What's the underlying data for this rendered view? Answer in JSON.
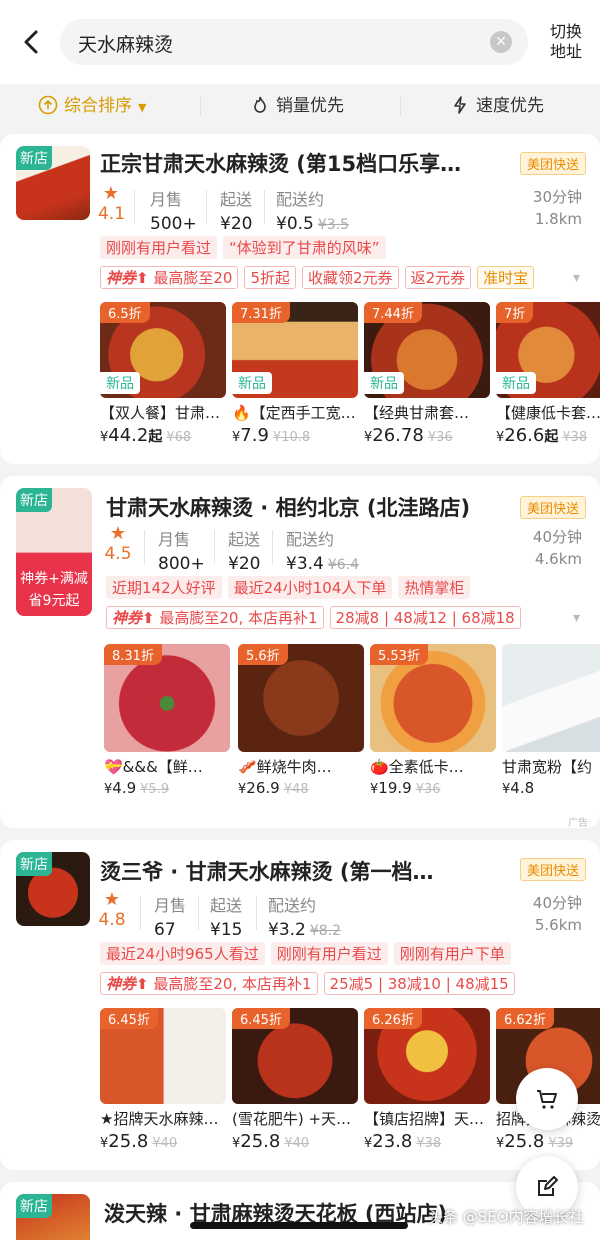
{
  "search": {
    "query": "天水麻辣烫",
    "switch_label": "切换\n地址"
  },
  "sort": {
    "tabs": [
      "综合排序",
      "销量优先",
      "速度优先"
    ]
  },
  "stat_labels": {
    "monthly": "月售",
    "min": "起送",
    "delivery": "配送约"
  },
  "stores": [
    {
      "new_label": "新店",
      "name": "正宗甘肃天水麻辣烫 (第15档口乐享…",
      "badge": "美团快送",
      "rating": "4.1",
      "monthly": "500+",
      "min_order": "¥20",
      "delivery_fee": "¥0.5",
      "delivery_fee_orig": "¥3.5",
      "time": "30分钟",
      "distance": "1.8km",
      "tags": [
        "刚刚有用户看过",
        "“体验到了甘肃的风味”"
      ],
      "coupons": {
        "shen": "神券",
        "boost": "最高膨至20",
        "items": [
          "5折起",
          "收藏领2元券",
          "返2元券",
          "准时宝"
        ]
      },
      "dishes": [
        {
          "discount": "6.5折",
          "new": "新品",
          "name": "【双人餐】甘肃…",
          "price": "44.2",
          "suffix": "起",
          "orig": "¥68"
        },
        {
          "discount": "7.31折",
          "new": "新品",
          "name": "🔥【定西手工宽…",
          "price": "7.9",
          "suffix": "",
          "orig": "¥10.8"
        },
        {
          "discount": "7.44折",
          "new": "新品",
          "name": "【经典甘肃套…",
          "price": "26.78",
          "suffix": "",
          "orig": "¥36"
        },
        {
          "discount": "7折",
          "new": "新品",
          "name": "【健康低卡套…",
          "price": "26.6",
          "suffix": "起",
          "orig": "¥38"
        }
      ]
    },
    {
      "new_label": "新店",
      "logo_promo": "神券+满减\n省9元起",
      "name": "甘肃天水麻辣烫 · 相约北京 (北洼路店)",
      "badge": "美团快送",
      "rating": "4.5",
      "monthly": "800+",
      "min_order": "¥20",
      "delivery_fee": "¥3.4",
      "delivery_fee_orig": "¥6.4",
      "time": "40分钟",
      "distance": "4.6km",
      "tags": [
        "近期142人好评",
        "最近24小时104人下单",
        "热情掌柜"
      ],
      "coupons": {
        "shen": "神券",
        "boost": "最高膨至20, 本店再补1",
        "items": [
          "28减8 | 48减12 | 68减18"
        ]
      },
      "dishes": [
        {
          "discount": "8.31折",
          "name": "💝&&&【鲜…",
          "price": "4.9",
          "orig": "¥5.9"
        },
        {
          "discount": "5.6折",
          "name": "🥓鲜烧牛肉…",
          "price": "26.9",
          "orig": "¥48"
        },
        {
          "discount": "5.53折",
          "name": "🍅全素低卡…",
          "price": "19.9",
          "orig": "¥36"
        },
        {
          "discount": "",
          "name": "甘肃宽粉【约",
          "price": "4.8",
          "orig": ""
        }
      ],
      "ad": "广告"
    },
    {
      "new_label": "新店",
      "name": "烫三爷 · 甘肃天水麻辣烫 (第一档…",
      "badge": "美团快送",
      "rating": "4.8",
      "monthly": "67",
      "min_order": "¥15",
      "delivery_fee": "¥3.2",
      "delivery_fee_orig": "¥8.2",
      "time": "40分钟",
      "distance": "5.6km",
      "tags": [
        "最近24小时965人看过",
        "刚刚有用户看过",
        "刚刚有用户下单"
      ],
      "coupons": {
        "shen": "神券",
        "boost": "最高膨至20, 本店再补1",
        "items": [
          "25减5 | 38减10 | 48减15"
        ]
      },
      "dishes": [
        {
          "discount": "6.45折",
          "name": "★招牌天水麻辣…",
          "price": "25.8",
          "orig": "¥40"
        },
        {
          "discount": "6.45折",
          "name": "(雪花肥牛) +天…",
          "price": "25.8",
          "orig": "¥40"
        },
        {
          "discount": "6.26折",
          "name": "【镇店招牌】天…",
          "price": "23.8",
          "orig": "¥38"
        },
        {
          "discount": "6.62折",
          "name": "招牌天水麻辣烫",
          "price": "25.8",
          "orig": "¥39"
        }
      ]
    },
    {
      "new_label": "新店",
      "name": "泼天辣 · 甘肃麻辣烫天花板 (西站店)"
    }
  ],
  "watermark": "头条 @SEO内容增长社",
  "colors": {
    "accent": "#d99b00",
    "price_red": "#e84a4a",
    "new_green": "#2bb594",
    "discount_orange": "#e8632b"
  }
}
